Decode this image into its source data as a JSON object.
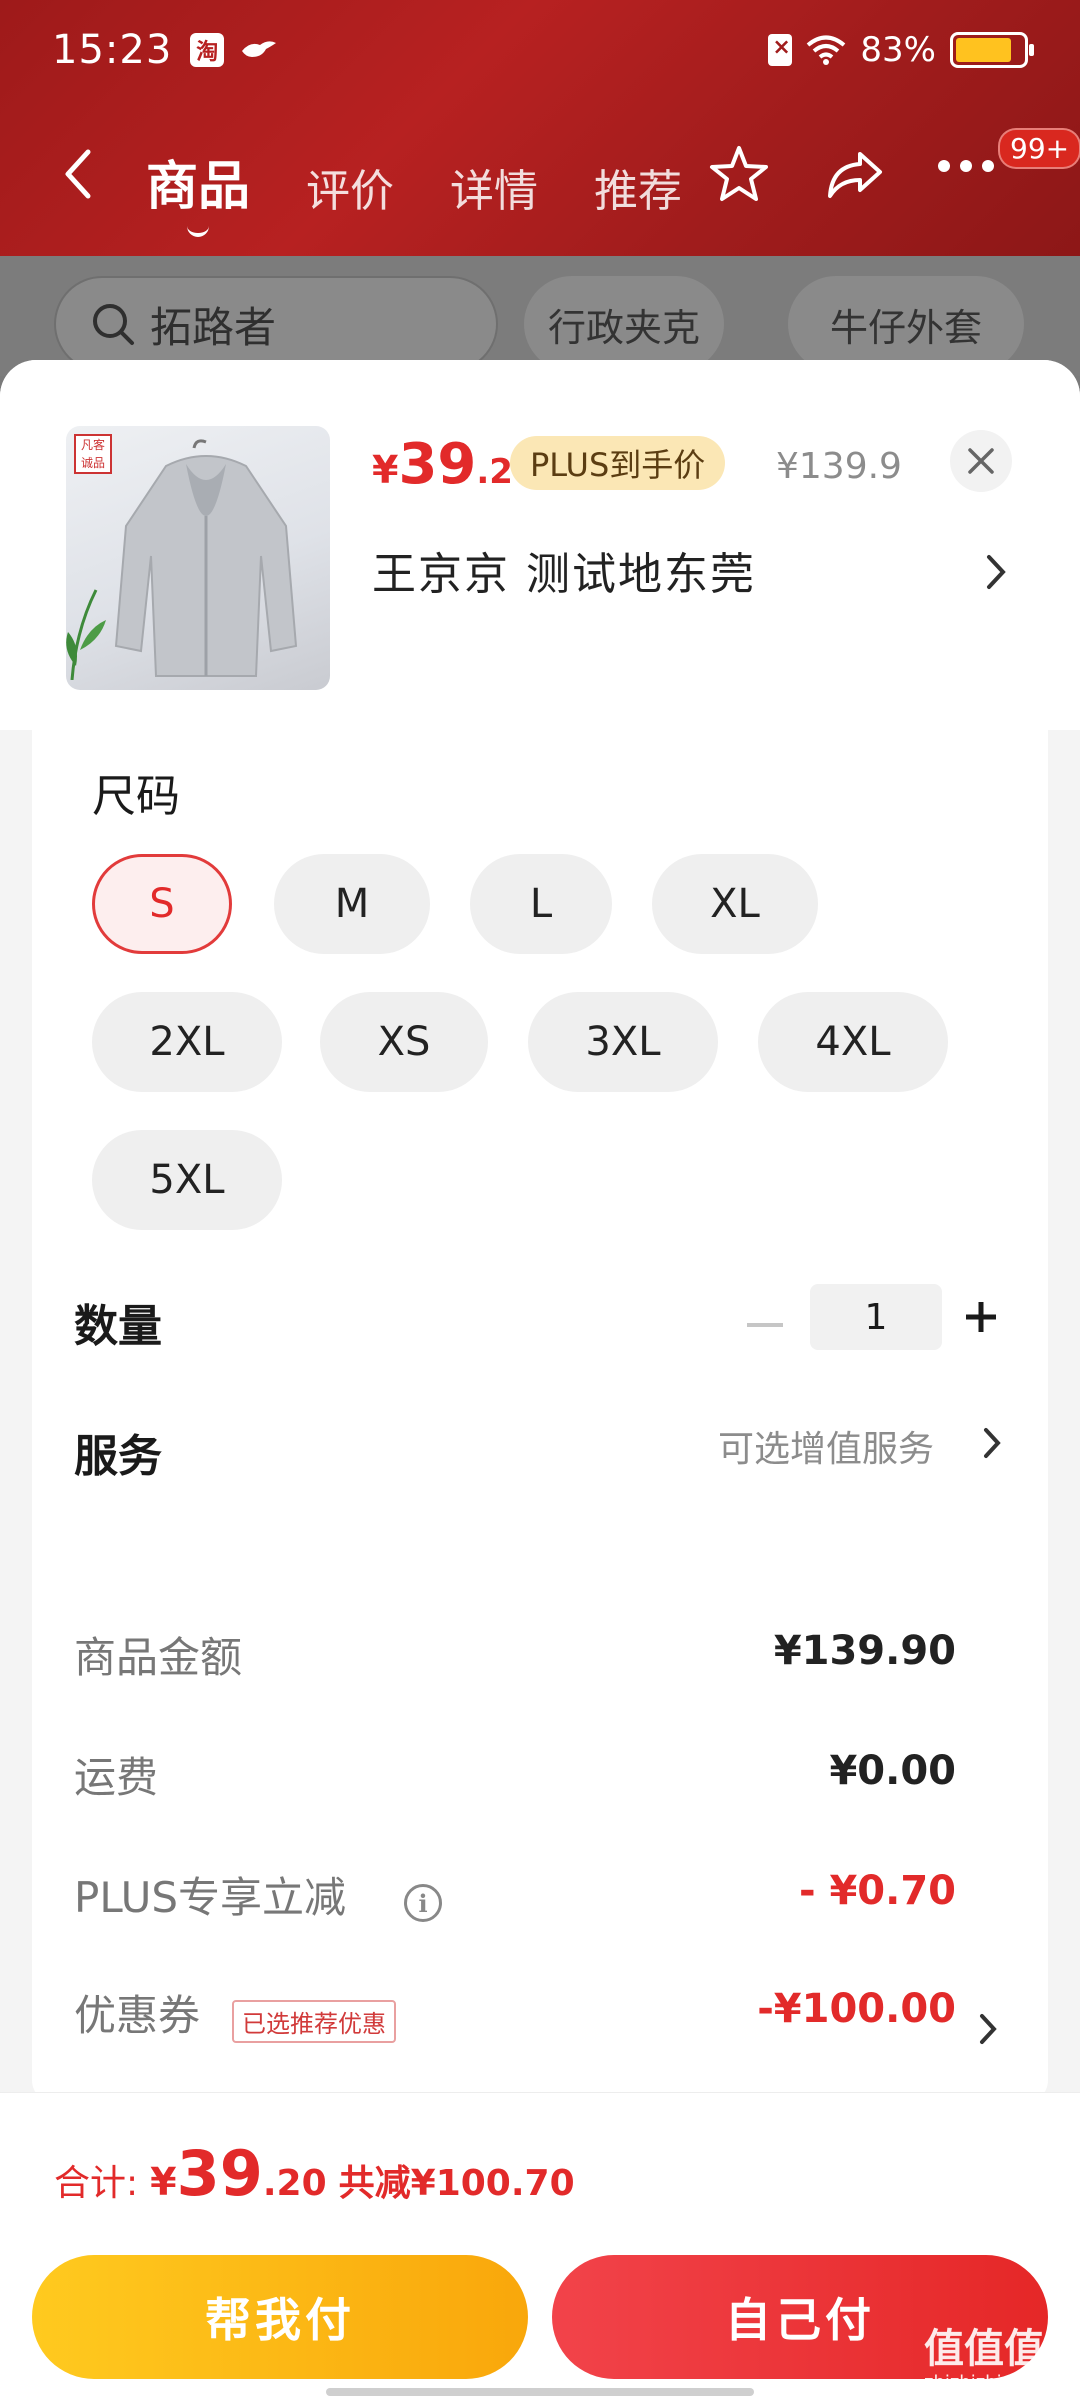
{
  "status_bar": {
    "time": "15:23",
    "app_icon_label": "淘",
    "battery_percent": "83%",
    "battery_level": 0.83
  },
  "nav": {
    "tabs": [
      {
        "label": "商品",
        "active": true
      },
      {
        "label": "评价",
        "active": false
      },
      {
        "label": "详情",
        "active": false
      },
      {
        "label": "推荐",
        "active": false
      }
    ],
    "badge": "99+"
  },
  "search": {
    "query": "拓路者",
    "chips": [
      "行政夹克",
      "牛仔外套"
    ]
  },
  "product": {
    "brand_tag": "凡客诚品",
    "price_yen": "¥",
    "price_int": "39",
    "price_dec": ".2",
    "plus_tag": "PLUS到手价",
    "original_price": "¥139.9",
    "address": "王京京  测试地东莞"
  },
  "options": {
    "size_label": "尺码",
    "sizes": [
      "S",
      "M",
      "L",
      "XL",
      "2XL",
      "XS",
      "3XL",
      "4XL",
      "5XL"
    ],
    "selected_size": "S",
    "quantity_label": "数量",
    "quantity": "1",
    "service_label": "服务",
    "service_hint": "可选增值服务"
  },
  "summary": {
    "rows": [
      {
        "label": "商品金额",
        "value": "¥139.90"
      },
      {
        "label": "运费",
        "value": "¥0.00"
      },
      {
        "label": "PLUS专享立减",
        "value": "- ¥0.70"
      },
      {
        "label": "优惠券",
        "value": "-¥100.00"
      }
    ],
    "coupon_tag": "已选推荐优惠"
  },
  "footer": {
    "total_label": "合计:",
    "total_yen": "¥",
    "total_int": "39",
    "total_dec": ".20",
    "total_reduce": "共减¥100.70",
    "btn_help": "帮我付",
    "btn_self": "自己付"
  },
  "watermark": {
    "main": "值值值",
    "sub": "zhizhizhi.com"
  },
  "colors": {
    "accent_red": "#e22a2a",
    "header_red": "#b72121",
    "yellow_button": "#f9b514",
    "plus_tag_bg": "#fbe7b5"
  }
}
